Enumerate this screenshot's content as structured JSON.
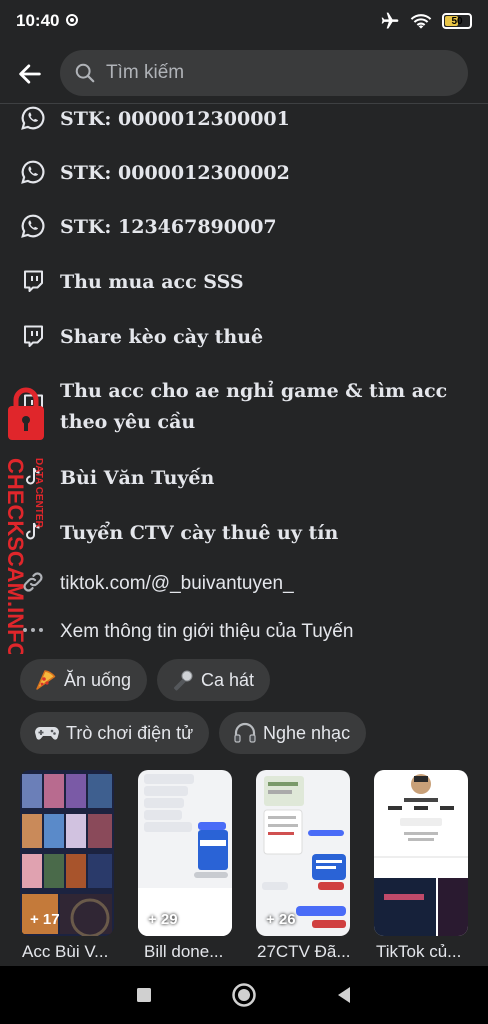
{
  "status_bar": {
    "time": "10:40",
    "battery": "50",
    "battery_level": 0.5
  },
  "search": {
    "placeholder": "Tìm kiếm"
  },
  "info_items": [
    {
      "icon": "whatsapp-icon",
      "text": "STK: 0000012300001"
    },
    {
      "icon": "whatsapp-icon",
      "text": "STK: 0000012300002"
    },
    {
      "icon": "whatsapp-icon",
      "text": "STK: 123467890007"
    },
    {
      "icon": "twitch-icon",
      "text": "Thu mua acc SSS"
    },
    {
      "icon": "twitch-icon",
      "text": "Share kèo cày thuê"
    },
    {
      "icon": "twitch-icon",
      "text": "Thu acc cho ae nghỉ game & tìm acc theo yêu cầu"
    },
    {
      "icon": "tiktok-icon",
      "text": "Bùi Văn Tuyến"
    },
    {
      "icon": "tiktok-icon",
      "text": "Tuyển CTV cày thuê uy tín"
    },
    {
      "icon": "link-icon",
      "text": "tiktok.com/@_buivantuyen_"
    },
    {
      "icon": "more-icon",
      "text": "Xem thông tin giới thiệu của Tuyến"
    }
  ],
  "interests": [
    {
      "icon": "pizza-icon",
      "label": "Ăn uống"
    },
    {
      "icon": "microphone-icon",
      "label": "Ca hát"
    },
    {
      "icon": "gamepad-icon",
      "label": "Trò chơi điện tử"
    },
    {
      "icon": "headphones-icon",
      "label": "Nghe nhạc"
    }
  ],
  "stories": [
    {
      "count": "+ 17",
      "title": "Acc Bùi V..."
    },
    {
      "count": "+ 29",
      "title": "Bill done..."
    },
    {
      "count": "+ 26",
      "title": "27CTV Đã..."
    },
    {
      "count": "",
      "title": "TikTok củ..."
    }
  ],
  "watermark": {
    "line1": "DATA CENTER",
    "line2": "CHECKSCAM.INFO"
  }
}
